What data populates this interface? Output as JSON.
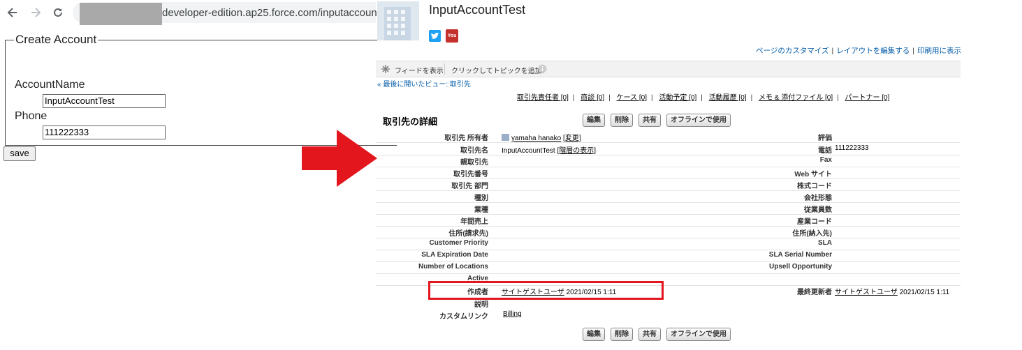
{
  "browser": {
    "url": "developer-edition.ap25.force.com/inputaccount"
  },
  "form": {
    "legend": "Create Account",
    "account_name_label": "AccountName",
    "account_name_value": "InputAccountTest",
    "phone_label": "Phone",
    "phone_value": "111222333",
    "save_label": "save"
  },
  "colors": {
    "arrow": "#e3161e",
    "highlight": "#e3161e",
    "link": "#015ba7"
  },
  "sf": {
    "title": "InputAccountTest",
    "top_links": [
      "ページのカスタマイズ",
      "レイアウトを編集する",
      "印刷用に表示"
    ],
    "feed_show": "フィードを表示",
    "feed_topic": "クリックしてトピックを追加:",
    "back_link": "« 最後に開いたビュー: 取引先",
    "related": [
      "取引先責任者 [0]",
      "商談 [0]",
      "ケース [0]",
      "活動予定 [0]",
      "活動履歴 [0]",
      "メモ & 添付ファイル [0]",
      "パートナー [0]"
    ],
    "section_title": "取引先の詳細",
    "buttons": [
      "編集",
      "削除",
      "共有",
      "オフラインで使用"
    ],
    "owner_value": "yamaha hanako",
    "owner_change": "[変更]",
    "name_value": "InputAccountTest",
    "name_hierarchy": "[階層の表示]",
    "phone_value": "111222333",
    "created_by_user": "サイトゲストユーザ",
    "created_by_date": "2021/02/15 1:11",
    "modified_by_user": "サイトゲストユーザ",
    "modified_by_date": "2021/02/15 1:11",
    "custom_link_value": "Billing",
    "left_labels": [
      "取引先 所有者",
      "取引先名",
      "親取引先",
      "取引先番号",
      "取引先 部門",
      "種別",
      "業種",
      "年間売上",
      "住所(請求先)",
      "Customer Priority",
      "SLA Expiration Date",
      "Number of Locations",
      "Active",
      "作成者",
      "説明",
      "カスタムリンク"
    ],
    "right_labels": [
      "評価",
      "電話",
      "Fax",
      "Web サイト",
      "株式コード",
      "会社形態",
      "従業員数",
      "産業コード",
      "住所(納入先)",
      "SLA",
      "SLA Serial Number",
      "Upsell Opportunity",
      "最終更新者"
    ]
  }
}
